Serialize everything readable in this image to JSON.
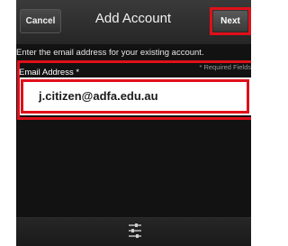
{
  "header": {
    "cancel_label": "Cancel",
    "title": "Add Account",
    "next_label": "Next"
  },
  "instructions": {
    "text": "Enter the email address for your existing account.",
    "required_note": "* Required Fields"
  },
  "form": {
    "email_label": "Email Address *",
    "email_value": "j.citizen@adfa.edu.au"
  },
  "bottom_bar": {
    "icon": "menu-sliders-icon"
  },
  "colors": {
    "highlight": "#e0101a",
    "background": "#121212"
  }
}
